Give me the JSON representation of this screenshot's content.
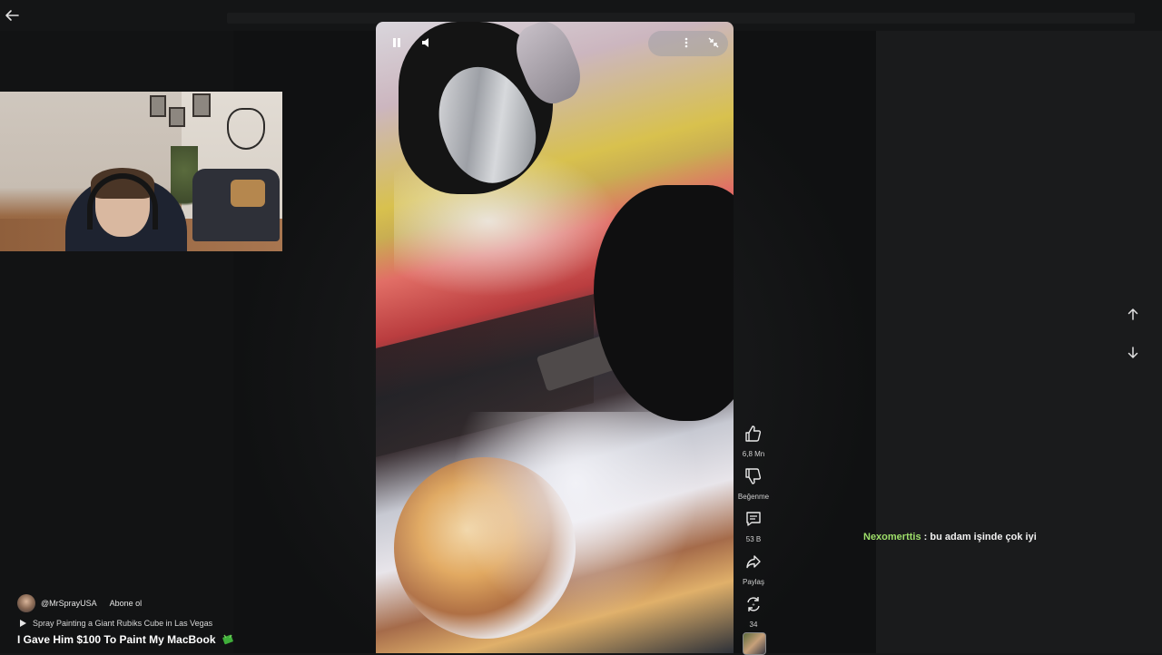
{
  "nav": {
    "back_icon": "arrow-left-icon"
  },
  "video": {
    "pause_icon": "pause-icon",
    "volume_icon": "volume-icon",
    "more_icon": "more-vertical-icon",
    "collapse_icon": "collapse-icon"
  },
  "actions": {
    "like_count": "6,8 Mn",
    "dislike_label": "Beğenme",
    "comment_count": "53 B",
    "share_label": "Paylaş",
    "remix_count": "34"
  },
  "chat": {
    "username": "Nexomerttis",
    "separator": ":",
    "message": "bu adam işinde çok iyi"
  },
  "channel": {
    "handle": "@MrSprayUSA",
    "subscribe_label": "Abone ol"
  },
  "related": {
    "title": "Spray Painting a Giant Rubiks Cube in Las Vegas"
  },
  "short": {
    "title": "I Gave Him $100 To Paint My MacBook"
  },
  "colors": {
    "background": "#161718",
    "chat_username": "#9fe06a",
    "emoji_green": "#3fae3a"
  }
}
